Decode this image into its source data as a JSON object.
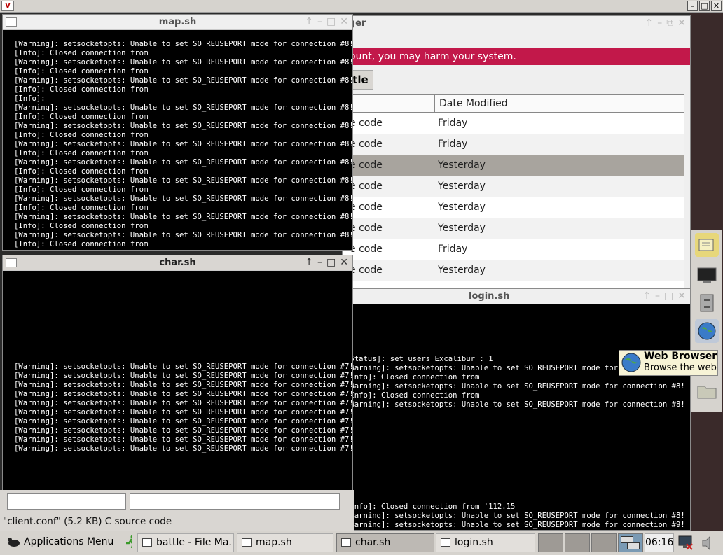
{
  "windows": {
    "map": {
      "title": "map.sh",
      "lines": [
        "[Warning]: setsocketopts: Unable to set SO_REUSEPORT mode for connection #8!",
        "[Info]: Closed connection from",
        "[Warning]: setsocketopts: Unable to set SO_REUSEPORT mode for connection #8!",
        "[Info]: Closed connection from",
        "[Warning]: setsocketopts: Unable to set SO_REUSEPORT mode for connection #8!",
        "[Info]: Closed connection from",
        "[Info]:",
        "[Warning]: setsocketopts: Unable to set SO_REUSEPORT mode for connection #8!",
        "[Info]: Closed connection from",
        "[Warning]: setsocketopts: Unable to set SO_REUSEPORT mode for connection #8!",
        "[Info]: Closed connection from",
        "[Warning]: setsocketopts: Unable to set SO_REUSEPORT mode for connection #8!",
        "[Info]: Closed connection from",
        "[Warning]: setsocketopts: Unable to set SO_REUSEPORT mode for connection #8!",
        "[Info]: Closed connection from",
        "[Warning]: setsocketopts: Unable to set SO_REUSEPORT mode for connection #8!",
        "[Info]: Closed connection from",
        "[Warning]: setsocketopts: Unable to set SO_REUSEPORT mode for connection #8!",
        "[Info]: Closed connection from",
        "[Warning]: setsocketopts: Unable to set SO_REUSEPORT mode for connection #8!",
        "[Info]: Closed connection from",
        "[Warning]: setsocketopts: Unable to set SO_REUSEPORT mode for connection #8!",
        "[Info]: Closed connection from"
      ]
    },
    "char": {
      "title": "char.sh",
      "lines": [
        "[Warning]: setsocketopts: Unable to set SO_REUSEPORT mode for connection #7!",
        "[Warning]: setsocketopts: Unable to set SO_REUSEPORT mode for connection #7!",
        "[Warning]: setsocketopts: Unable to set SO_REUSEPORT mode for connection #7!",
        "[Warning]: setsocketopts: Unable to set SO_REUSEPORT mode for connection #7!",
        "[Warning]: setsocketopts: Unable to set SO_REUSEPORT mode for connection #7!",
        "[Warning]: setsocketopts: Unable to set SO_REUSEPORT mode for connection #7!",
        "[Warning]: setsocketopts: Unable to set SO_REUSEPORT mode for connection #7!",
        "[Warning]: setsocketopts: Unable to set SO_REUSEPORT mode for connection #7!",
        "[Warning]: setsocketopts: Unable to set SO_REUSEPORT mode for connection #7!",
        "[Warning]: setsocketopts: Unable to set SO_REUSEPORT mode for connection #7!"
      ]
    },
    "login": {
      "title": "login.sh",
      "lines_top": [
        "[Status]: set users Excalibur : 1",
        "[Warning]: setsocketopts: Unable to set SO_REUSEPORT mode for co",
        "[Info]: Closed connection from",
        "[Warning]: setsocketopts: Unable to set SO_REUSEPORT mode for connection #8!",
        "[Info]: Closed connection from",
        "[Warning]: setsocketopts: Unable to set SO_REUSEPORT mode for connection #8!"
      ],
      "lines_bottom": [
        "[Info]: Closed connection from '112.15",
        "[Warning]: setsocketopts: Unable to set SO_REUSEPORT mode for connection #8!",
        "[Warning]: setsocketopts: Unable to set SO_REUSEPORT mode for connection #9!"
      ]
    },
    "filemanager": {
      "title_fragment": "ager",
      "warning_fragment": "ount, you may harm your system.",
      "path_button": "ttle",
      "column_date": "Date Modified",
      "rows": [
        {
          "type": "e code",
          "date": "Friday",
          "selected": false
        },
        {
          "type": "e code",
          "date": "Friday",
          "selected": false
        },
        {
          "type": "e code",
          "date": "Yesterday",
          "selected": true
        },
        {
          "type": "e code",
          "date": "Yesterday",
          "selected": false
        },
        {
          "type": "e code",
          "date": "Yesterday",
          "selected": false
        },
        {
          "type": "e code",
          "date": "Yesterday",
          "selected": false
        },
        {
          "type": "e code",
          "date": "Friday",
          "selected": false
        },
        {
          "type": "e code",
          "date": "Yesterday",
          "selected": false
        }
      ],
      "status": "\"client.conf\" (5.2 KB) C source code"
    }
  },
  "tooltip": {
    "title": "Web Browser",
    "subtitle": "Browse the web"
  },
  "taskbar": {
    "apps_menu": "Applications Menu",
    "tasks": [
      {
        "label": "battle - File Ma...",
        "active": false
      },
      {
        "label": "map.sh",
        "active": false
      },
      {
        "label": "char.sh",
        "active": true
      },
      {
        "label": "login.sh",
        "active": false
      }
    ],
    "clock": "06:16"
  },
  "colors": {
    "warning_bar": "#c2184a",
    "selected_row": "#a8a49e"
  }
}
